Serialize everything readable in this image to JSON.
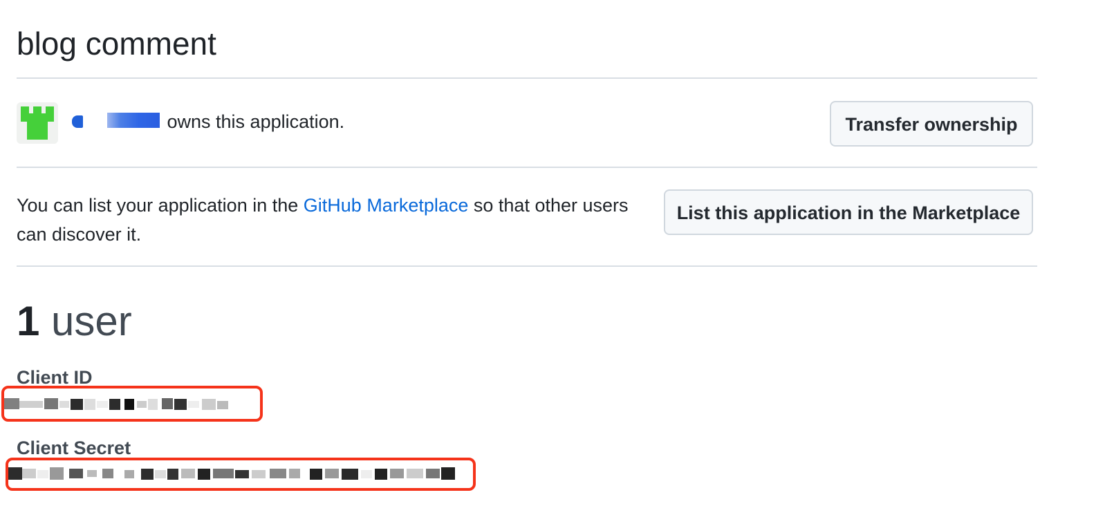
{
  "app": {
    "title": "blog comment"
  },
  "owner": {
    "avatar_icon": "identicon-icon",
    "owns_text": " owns this application.",
    "transfer_label": "Transfer ownership"
  },
  "marketplace": {
    "text_before": "You can list your application in the ",
    "link_label": "GitHub Marketplace",
    "text_after": " so that other users can discover it.",
    "button_label": "List this application in the Marketplace"
  },
  "users": {
    "count": "1",
    "label": " user"
  },
  "credentials": {
    "client_id_label": "Client ID",
    "client_secret_label": "Client Secret"
  },
  "colors": {
    "link": "#0969da",
    "highlight_box": "#f5331a",
    "avatar_green": "#45d03a"
  }
}
